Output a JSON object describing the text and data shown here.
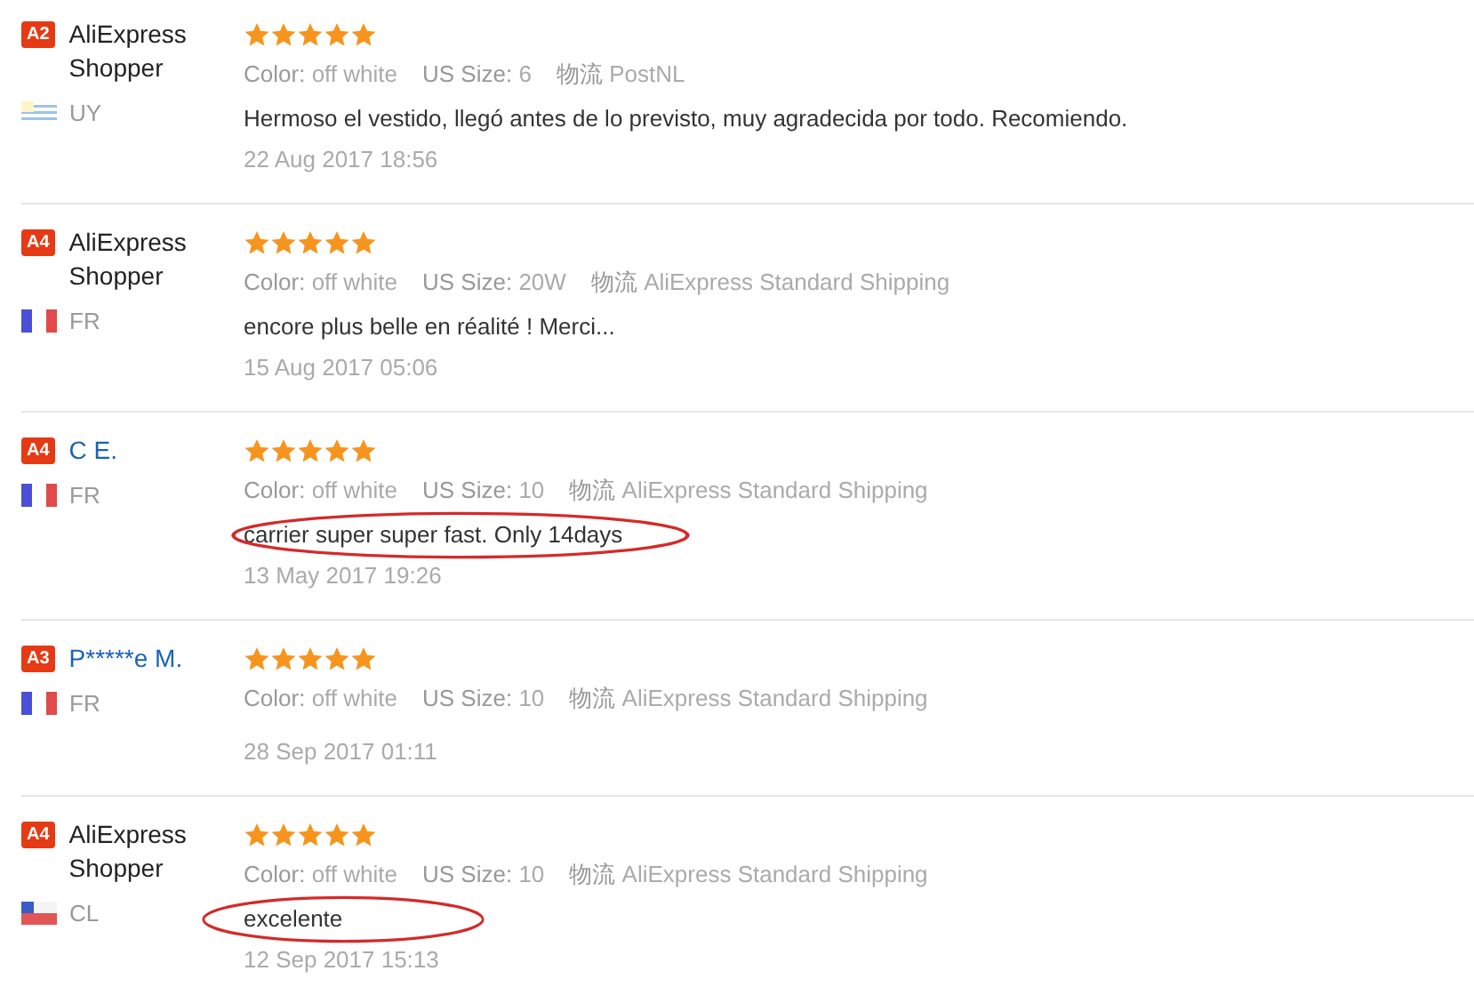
{
  "reviews": [
    {
      "badge": "A2",
      "name": "AliExpress Shopper",
      "is_link": false,
      "flag": {
        "kind": "uy"
      },
      "country": "UY",
      "stars": 5,
      "attributes": [
        {
          "label": "Color:",
          "value": "off white"
        },
        {
          "label": "US Size:",
          "value": "6"
        },
        {
          "label": "物流",
          "value": "PostNL"
        }
      ],
      "comment": "Hermoso el vestido, llegó antes de lo previsto, muy agradecida por todo. Recomiendo.",
      "date": "22 Aug 2017 18:56",
      "circled": false
    },
    {
      "badge": "A4",
      "name": "AliExpress Shopper",
      "is_link": false,
      "flag": {
        "kind": "fr"
      },
      "country": "FR",
      "stars": 5,
      "attributes": [
        {
          "label": "Color:",
          "value": "off white"
        },
        {
          "label": "US Size:",
          "value": "20W"
        },
        {
          "label": "物流",
          "value": "AliExpress Standard Shipping"
        }
      ],
      "comment": "encore plus belle en réalité ! Merci...",
      "date": "15 Aug 2017 05:06",
      "circled": false
    },
    {
      "badge": "A4",
      "name": "C E.",
      "is_link": true,
      "flag": {
        "kind": "fr"
      },
      "country": "FR",
      "stars": 5,
      "attributes": [
        {
          "label": "Color:",
          "value": "off white"
        },
        {
          "label": "US Size:",
          "value": "10"
        },
        {
          "label": "物流",
          "value": "AliExpress Standard Shipping"
        }
      ],
      "comment": "carrier super super fast. Only 14days",
      "date": "13 May 2017 19:26",
      "circled": true
    },
    {
      "badge": "A3",
      "name": "P*****e M.",
      "is_link": true,
      "flag": {
        "kind": "fr"
      },
      "country": "FR",
      "stars": 5,
      "attributes": [
        {
          "label": "Color:",
          "value": "off white"
        },
        {
          "label": "US Size:",
          "value": "10"
        },
        {
          "label": "物流",
          "value": "AliExpress Standard Shipping"
        }
      ],
      "date": "28 Sep 2017 01:11",
      "circled": false
    },
    {
      "badge": "A4",
      "name": "AliExpress Shopper",
      "is_link": false,
      "flag": {
        "kind": "cl"
      },
      "country": "CL",
      "stars": 5,
      "attributes": [
        {
          "label": "Color:",
          "value": "off white"
        },
        {
          "label": "US Size:",
          "value": "10"
        },
        {
          "label": "物流",
          "value": "AliExpress Standard Shipping"
        }
      ],
      "comment": "excelente",
      "date": "12 Sep 2017 15:13",
      "circled": true
    }
  ]
}
